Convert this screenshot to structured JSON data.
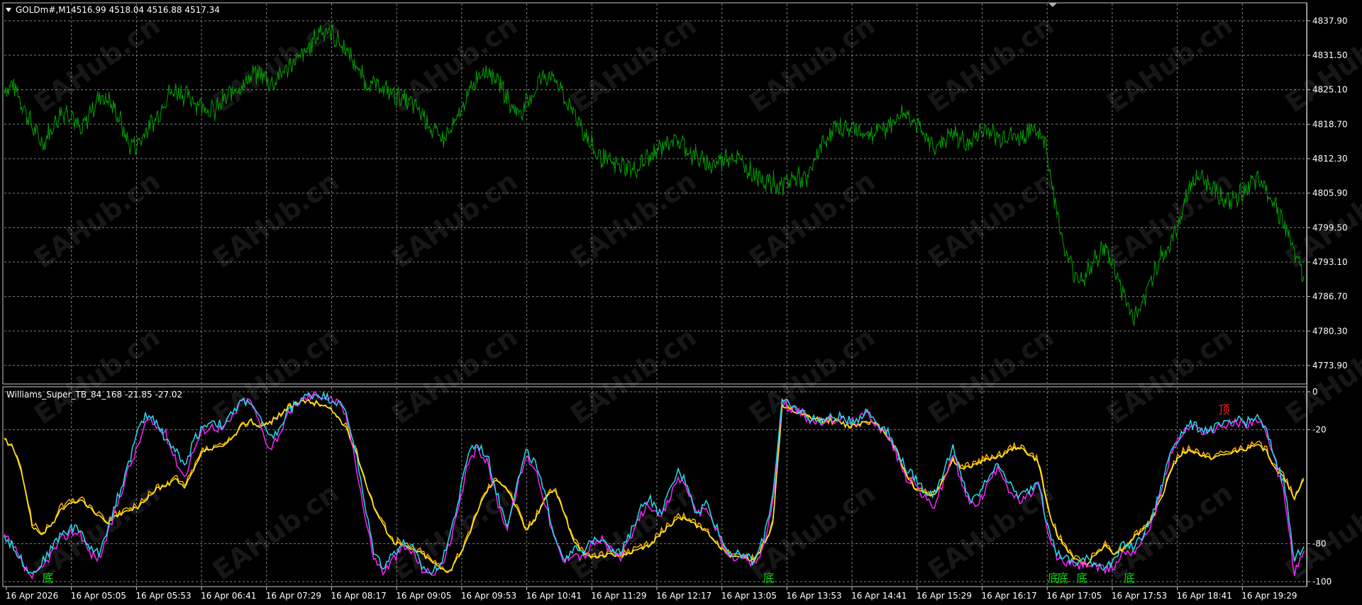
{
  "main_pane": {
    "symbol_label": "GOLDm#,M1",
    "ohlc_label": "4516.99 4518.04 4516.88 4517.34"
  },
  "indicator_pane": {
    "label": "Williams_Super_TB_84_168 -21.85 -27.02"
  },
  "watermark": "EAHub.cn",
  "colors": {
    "background": "#000000",
    "price": "#00a000",
    "grid": "#7f7f7f",
    "cyan": "#22ddee",
    "magenta": "#ff22ff",
    "orange": "#ffaa00",
    "yellow": "#ffee22",
    "bottom_signal": "#00dd00",
    "top_signal": "#ff2020"
  },
  "chart_data": [
    {
      "type": "line",
      "title": "GOLDm#,M1",
      "ylim": [
        4770.6,
        4841.1
      ],
      "y_ticks": [
        "4837.90",
        "4831.50",
        "4825.10",
        "4818.70",
        "4812.30",
        "4805.90",
        "4799.50",
        "4793.10",
        "4786.70",
        "4780.30",
        "4773.90"
      ],
      "x_ticks": [
        "16 Apr 2026",
        "16 Apr 05:05",
        "16 Apr 05:53",
        "16 Apr 06:41",
        "16 Apr 07:29",
        "16 Apr 08:17",
        "16 Apr 09:05",
        "16 Apr 09:53",
        "16 Apr 10:41",
        "16 Apr 11:29",
        "16 Apr 12:17",
        "16 Apr 13:05",
        "16 Apr 13:53",
        "16 Apr 14:41",
        "16 Apr 15:29",
        "16 Apr 16:17",
        "16 Apr 17:05",
        "16 Apr 17:53",
        "16 Apr 18:41",
        "16 Apr 19:29"
      ],
      "grid": true,
      "series": [
        {
          "role": "price",
          "values": [
            4825,
            4826,
            4822,
            4818,
            4815,
            4818,
            4821,
            4821,
            4817,
            4821,
            4824,
            4823,
            4820,
            4815,
            4815,
            4818,
            4820,
            4824,
            4825,
            4824,
            4823,
            4822,
            4821,
            4823,
            4825,
            4826,
            4828,
            4828,
            4826,
            4828,
            4830,
            4831,
            4833,
            4836,
            4836,
            4834,
            4832,
            4829,
            4826,
            4826,
            4825,
            4824,
            4823,
            4822,
            4820,
            4817,
            4816,
            4818,
            4822,
            4826,
            4829,
            4828,
            4826,
            4822,
            4821,
            4823,
            4827,
            4828,
            4826,
            4822,
            4820,
            4816,
            4813,
            4812,
            4811,
            4811,
            4810,
            4812,
            4813,
            4815,
            4816,
            4815,
            4813,
            4812,
            4811,
            4812,
            4813,
            4812,
            4810,
            4809,
            4808,
            4807,
            4808,
            4809,
            4808,
            4813,
            4816,
            4818,
            4818,
            4818,
            4817,
            4817,
            4818,
            4819,
            4821,
            4820,
            4817,
            4815,
            4815,
            4817,
            4816,
            4815,
            4817,
            4818,
            4816,
            4817,
            4816,
            4817,
            4818,
            4815,
            4804,
            4795,
            4791,
            4790,
            4793,
            4796,
            4793,
            4788,
            4783,
            4784,
            4790,
            4794,
            4796,
            4801,
            4807,
            4809,
            4808,
            4806,
            4804,
            4805,
            4807,
            4808,
            4807,
            4804,
            4800,
            4795,
            4790
          ]
        }
      ]
    },
    {
      "type": "line",
      "title": "Williams_Super_TB_84_168",
      "ylim": [
        -100,
        0
      ],
      "y_ticks": [
        "0",
        "-20",
        "-80",
        "-100"
      ],
      "series": [
        {
          "color": "cyan",
          "values": [
            -76,
            -82,
            -90,
            -96,
            -90,
            -82,
            -75,
            -72,
            -72,
            -83,
            -85,
            -70,
            -55,
            -40,
            -22,
            -12,
            -15,
            -25,
            -30,
            -40,
            -25,
            -18,
            -15,
            -18,
            -12,
            -5,
            -5,
            -15,
            -25,
            -20,
            -10,
            -5,
            -2,
            -1,
            -3,
            -5,
            -10,
            -30,
            -60,
            -85,
            -92,
            -85,
            -80,
            -82,
            -92,
            -96,
            -90,
            -75,
            -55,
            -30,
            -28,
            -35,
            -55,
            -70,
            -50,
            -32,
            -38,
            -55,
            -75,
            -88,
            -82,
            -86,
            -78,
            -76,
            -82,
            -85,
            -75,
            -62,
            -55,
            -65,
            -55,
            -42,
            -48,
            -65,
            -58,
            -70,
            -82,
            -86,
            -85,
            -90,
            -78,
            -55,
            -5,
            -8,
            -10,
            -14,
            -15,
            -14,
            -13,
            -15,
            -14,
            -10,
            -16,
            -20,
            -30,
            -40,
            -45,
            -52,
            -54,
            -42,
            -30,
            -47,
            -58,
            -52,
            -42,
            -38,
            -49,
            -55,
            -52,
            -46,
            -72,
            -85,
            -88,
            -90,
            -88,
            -90,
            -92,
            -90,
            -80,
            -82,
            -76,
            -66,
            -50,
            -30,
            -22,
            -17,
            -19,
            -20,
            -18,
            -17,
            -15,
            -16,
            -13,
            -20,
            -35,
            -50,
            -90,
            -80
          ]
        },
        {
          "color": "magenta",
          "values": [
            -76,
            -82,
            -92,
            -98,
            -93,
            -85,
            -78,
            -74,
            -74,
            -85,
            -88,
            -74,
            -58,
            -42,
            -30,
            -15,
            -18,
            -22,
            -35,
            -45,
            -30,
            -20,
            -18,
            -20,
            -14,
            -5,
            -5,
            -18,
            -30,
            -22,
            -12,
            -5,
            -3,
            -1,
            -3,
            -5,
            -12,
            -35,
            -65,
            -88,
            -95,
            -88,
            -82,
            -84,
            -93,
            -96,
            -92,
            -80,
            -60,
            -35,
            -30,
            -38,
            -58,
            -72,
            -52,
            -34,
            -40,
            -58,
            -78,
            -90,
            -84,
            -88,
            -80,
            -78,
            -84,
            -87,
            -78,
            -66,
            -58,
            -68,
            -58,
            -45,
            -50,
            -66,
            -60,
            -72,
            -84,
            -88,
            -87,
            -92,
            -82,
            -60,
            -6,
            -9,
            -11,
            -15,
            -16,
            -15,
            -14,
            -16,
            -15,
            -11,
            -17,
            -22,
            -32,
            -45,
            -48,
            -56,
            -60,
            -48,
            -32,
            -50,
            -60,
            -56,
            -45,
            -40,
            -52,
            -58,
            -55,
            -48,
            -75,
            -87,
            -90,
            -92,
            -90,
            -92,
            -94,
            -92,
            -84,
            -84,
            -78,
            -68,
            -52,
            -32,
            -23,
            -18,
            -20,
            -21,
            -19,
            -17,
            -16,
            -17,
            -14,
            -22,
            -38,
            -55,
            -96,
            -84
          ]
        },
        {
          "color": "orange",
          "values": [
            -25,
            -30,
            -45,
            -70,
            -74,
            -70,
            -60,
            -58,
            -56,
            -60,
            -65,
            -68,
            -64,
            -62,
            -60,
            -56,
            -50,
            -50,
            -45,
            -50,
            -40,
            -30,
            -30,
            -28,
            -25,
            -18,
            -15,
            -18,
            -16,
            -12,
            -8,
            -6,
            -5,
            -6,
            -8,
            -12,
            -18,
            -30,
            -45,
            -60,
            -70,
            -78,
            -80,
            -82,
            -84,
            -88,
            -92,
            -94,
            -85,
            -75,
            -60,
            -50,
            -45,
            -50,
            -60,
            -72,
            -66,
            -55,
            -50,
            -62,
            -78,
            -84,
            -86,
            -86,
            -84,
            -86,
            -84,
            -82,
            -80,
            -75,
            -70,
            -66,
            -66,
            -70,
            -72,
            -78,
            -84,
            -86,
            -86,
            -88,
            -80,
            -70,
            -8,
            -10,
            -12,
            -14,
            -15,
            -15,
            -16,
            -18,
            -17,
            -15,
            -18,
            -22,
            -30,
            -42,
            -50,
            -52,
            -54,
            -45,
            -35,
            -40,
            -38,
            -36,
            -34,
            -33,
            -30,
            -28,
            -32,
            -36,
            -60,
            -75,
            -82,
            -88,
            -90,
            -85,
            -80,
            -84,
            -82,
            -76,
            -72,
            -66,
            -55,
            -40,
            -32,
            -30,
            -32,
            -34,
            -33,
            -32,
            -30,
            -29,
            -27,
            -30,
            -40,
            -45,
            -55,
            -45
          ]
        },
        {
          "color": "yellow",
          "values": [
            -25,
            -30,
            -46,
            -72,
            -75,
            -70,
            -62,
            -59,
            -57,
            -61,
            -66,
            -69,
            -65,
            -63,
            -61,
            -57,
            -51,
            -50,
            -46,
            -51,
            -41,
            -31,
            -30,
            -29,
            -25,
            -18,
            -15,
            -19,
            -16,
            -12,
            -8,
            -6,
            -5,
            -6,
            -8,
            -12,
            -19,
            -31,
            -46,
            -61,
            -71,
            -79,
            -81,
            -83,
            -85,
            -89,
            -93,
            -94,
            -86,
            -76,
            -61,
            -51,
            -46,
            -51,
            -61,
            -73,
            -67,
            -56,
            -51,
            -63,
            -79,
            -85,
            -87,
            -87,
            -85,
            -87,
            -85,
            -83,
            -81,
            -76,
            -71,
            -67,
            -67,
            -71,
            -73,
            -79,
            -85,
            -87,
            -87,
            -89,
            -81,
            -71,
            -8,
            -10,
            -12,
            -14,
            -15,
            -15,
            -16,
            -18,
            -17,
            -15,
            -18,
            -22,
            -30,
            -43,
            -51,
            -53,
            -55,
            -46,
            -36,
            -41,
            -39,
            -37,
            -35,
            -34,
            -31,
            -29,
            -33,
            -37,
            -61,
            -76,
            -83,
            -89,
            -91,
            -86,
            -81,
            -85,
            -83,
            -77,
            -73,
            -67,
            -56,
            -41,
            -33,
            -31,
            -33,
            -35,
            -34,
            -33,
            -31,
            -30,
            -28,
            -31,
            -41,
            -46,
            -56,
            -46
          ]
        }
      ],
      "signals": [
        {
          "label": "底",
          "kind": "bottom",
          "index": 4,
          "value": -95
        },
        {
          "label": "底",
          "kind": "bottom",
          "index": 80,
          "value": -95
        },
        {
          "label": "底",
          "kind": "bottom",
          "index": 110,
          "value": -95
        },
        {
          "label": "底",
          "kind": "bottom",
          "index": 111,
          "value": -95
        },
        {
          "label": "底",
          "kind": "bottom",
          "index": 113,
          "value": -95
        },
        {
          "label": "底",
          "kind": "bottom",
          "index": 118,
          "value": -95
        },
        {
          "label": "顶",
          "kind": "top",
          "index": 128,
          "value": -10
        }
      ]
    }
  ]
}
